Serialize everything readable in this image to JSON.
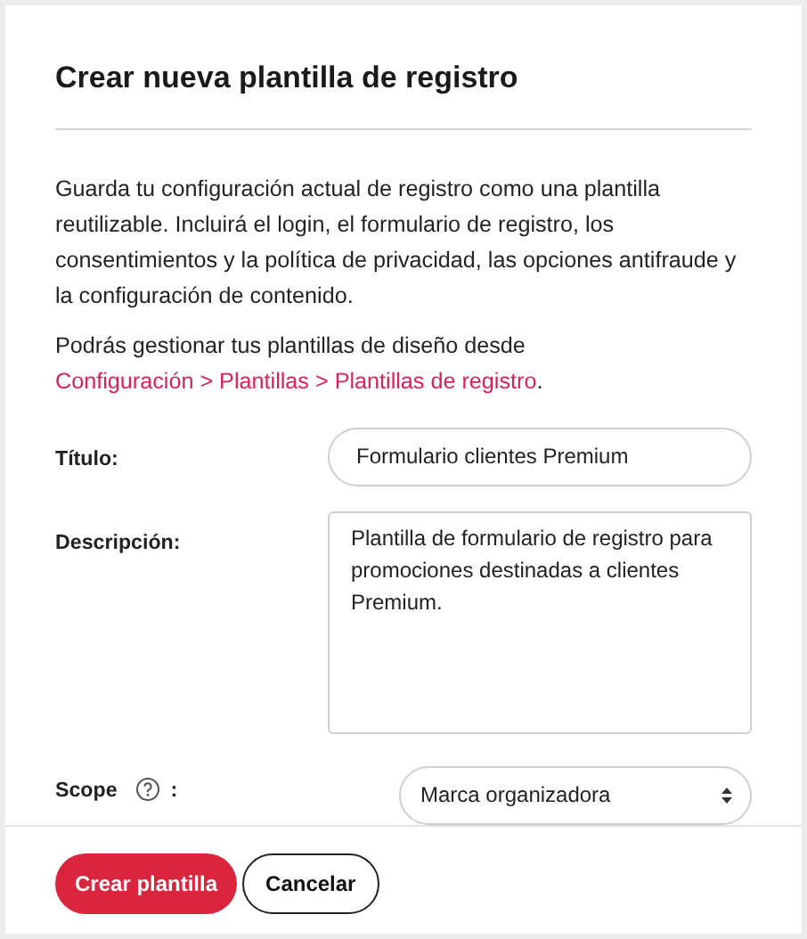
{
  "dialog": {
    "title": "Crear nueva plantilla de registro",
    "description": "Guarda tu configuración actual de registro como una plantilla reutilizable. Incluirá el login, el formulario de registro, los consentimientos y la política de privacidad, las opciones antifraude y la configuración de contenido.",
    "manage_note": {
      "text": "Podrás gestionar tus plantillas de diseño desde",
      "link": "Configuración > Plantillas > Plantillas de registro",
      "suffix": "."
    },
    "fields": [
      {
        "kind": "text",
        "label": "Título:",
        "value": "Formulario clientes Premium"
      },
      {
        "kind": "textarea",
        "label": "Descripción:",
        "value": "Plantilla de formulario de registro para promociones destinadas a clientes Premium."
      },
      {
        "kind": "select",
        "label": "Scope",
        "help": true,
        "label_suffix": ":",
        "value": "Marca organizadora"
      }
    ],
    "buttons": [
      {
        "kind": "primary",
        "label": "Crear plantilla"
      },
      {
        "kind": "secondary",
        "label": "Cancelar"
      }
    ]
  }
}
